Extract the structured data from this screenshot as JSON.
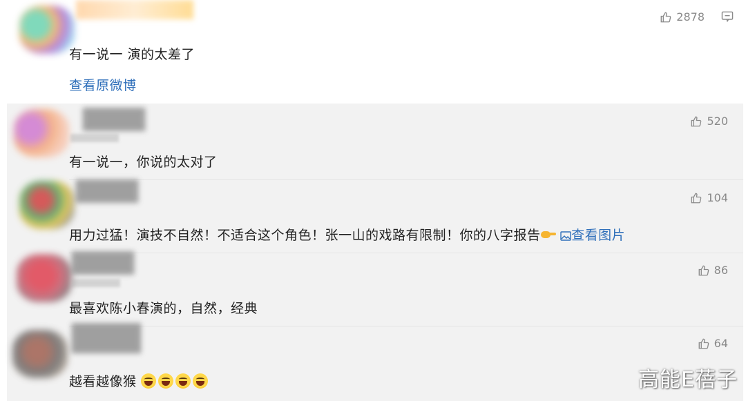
{
  "top_comment": {
    "likes": "2878",
    "text": "有一说一 演的太差了",
    "view_original": "查看原微博"
  },
  "replies": [
    {
      "likes": "520",
      "text": "有一说一，你说的太对了"
    },
    {
      "likes": "104",
      "text": "用力过猛！演技不自然！不适合这个角色！张一山的戏路有限制！你的八字报告",
      "pic_link": "查看图片"
    },
    {
      "likes": "86",
      "text": "最喜欢陈小春演的，自然，经典"
    },
    {
      "likes": "64",
      "text": "越看越像猴"
    }
  ],
  "watermark": "高能E蓓子",
  "colors": {
    "link": "#2f6fba",
    "panel_bg": "#f2f2f2",
    "like_gray": "#8a8a8a"
  }
}
